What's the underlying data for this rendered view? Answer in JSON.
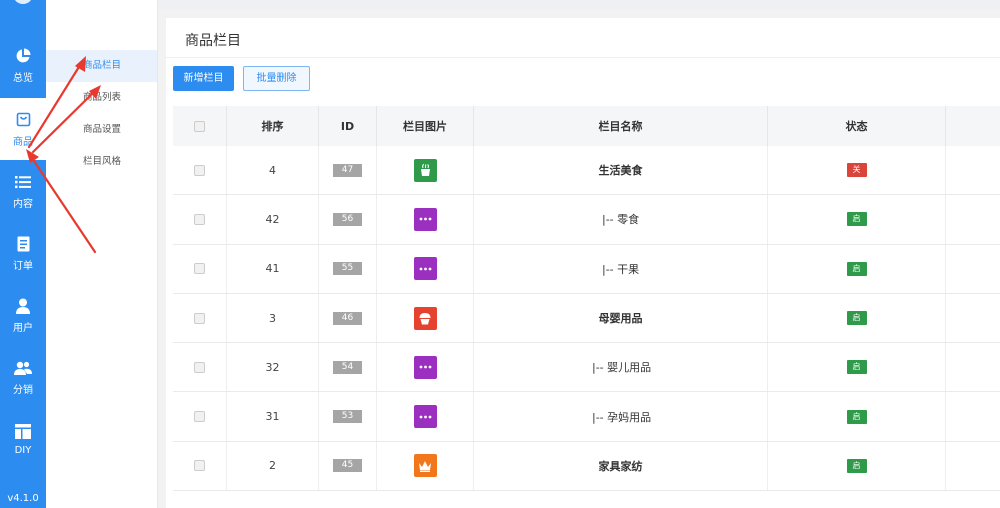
{
  "rail": {
    "items": [
      {
        "label": "总览",
        "icon": "pie-chart-icon"
      },
      {
        "label": "商品",
        "icon": "shopping-bag-icon"
      },
      {
        "label": "内容",
        "icon": "list-icon"
      },
      {
        "label": "订单",
        "icon": "document-icon"
      },
      {
        "label": "用户",
        "icon": "user-icon"
      },
      {
        "label": "分销",
        "icon": "users-icon"
      },
      {
        "label": "DIY",
        "icon": "layout-icon"
      }
    ],
    "active_index": 1,
    "version": "v4.1.0"
  },
  "submenu": {
    "items": [
      "商品栏目",
      "商品列表",
      "商品设置",
      "栏目风格"
    ],
    "active_index": 0
  },
  "panel": {
    "title": "商品栏目",
    "add_button": "新增栏目",
    "batch_delete_button": "批量删除"
  },
  "table": {
    "headers": {
      "sort": "排序",
      "id": "ID",
      "image": "栏目图片",
      "name": "栏目名称",
      "status": "状态"
    },
    "rows": [
      {
        "sort": "4",
        "id": "47",
        "name": "生活美食",
        "level": 0,
        "status": "关",
        "image_color": "#2e9a4a",
        "image_icon": "food-icon"
      },
      {
        "sort": "42",
        "id": "56",
        "name": "|--  零食",
        "level": 1,
        "status": "启",
        "image_color": "#9b2fc0",
        "image_icon": "dots-icon"
      },
      {
        "sort": "41",
        "id": "55",
        "name": "|--  干果",
        "level": 1,
        "status": "启",
        "image_color": "#9b2fc0",
        "image_icon": "dots-icon"
      },
      {
        "sort": "3",
        "id": "46",
        "name": "母婴用品",
        "level": 0,
        "status": "启",
        "image_color": "#e5432f",
        "image_icon": "cupcake-icon"
      },
      {
        "sort": "32",
        "id": "54",
        "name": "|--  婴儿用品",
        "level": 2,
        "status": "启",
        "image_color": "#9b2fc0",
        "image_icon": "dots-icon"
      },
      {
        "sort": "31",
        "id": "53",
        "name": "|--  孕妈用品",
        "level": 2,
        "status": "启",
        "image_color": "#9b2fc0",
        "image_icon": "dots-icon"
      },
      {
        "sort": "2",
        "id": "45",
        "name": "家具家纺",
        "level": 0,
        "status": "启",
        "image_color": "#f2761c",
        "image_icon": "crown-icon"
      }
    ]
  },
  "colors": {
    "primary": "#2d8cf0",
    "status_on": "#2e9a4a",
    "status_off": "#d9453b",
    "annotation": "#e8392f"
  }
}
